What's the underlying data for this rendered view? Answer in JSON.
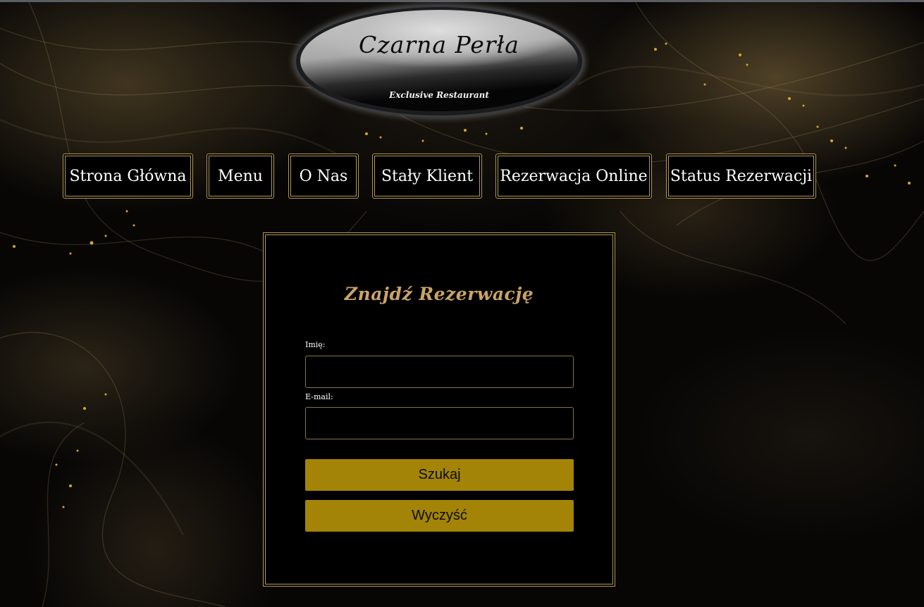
{
  "logo": {
    "title": "Czarna Perła",
    "subtitle": "Exclusive Restaurant"
  },
  "nav": {
    "items": [
      {
        "label": "Strona Główna"
      },
      {
        "label": "Menu"
      },
      {
        "label": "O Nas"
      },
      {
        "label": "Stały Klient"
      },
      {
        "label": "Rezerwacja Online"
      },
      {
        "label": "Status Rezerwacji"
      }
    ]
  },
  "form": {
    "title": "Znajdź Rezerwację",
    "name_label": "Imię:",
    "name_value": "",
    "email_label": "E-mail:",
    "email_value": "",
    "search_button": "Szukaj",
    "clear_button": "Wyczyść"
  },
  "colors": {
    "gold_accent": "#b59a55",
    "button_gold": "#a38406",
    "title_gold": "#c9a368",
    "background": "#050403"
  }
}
